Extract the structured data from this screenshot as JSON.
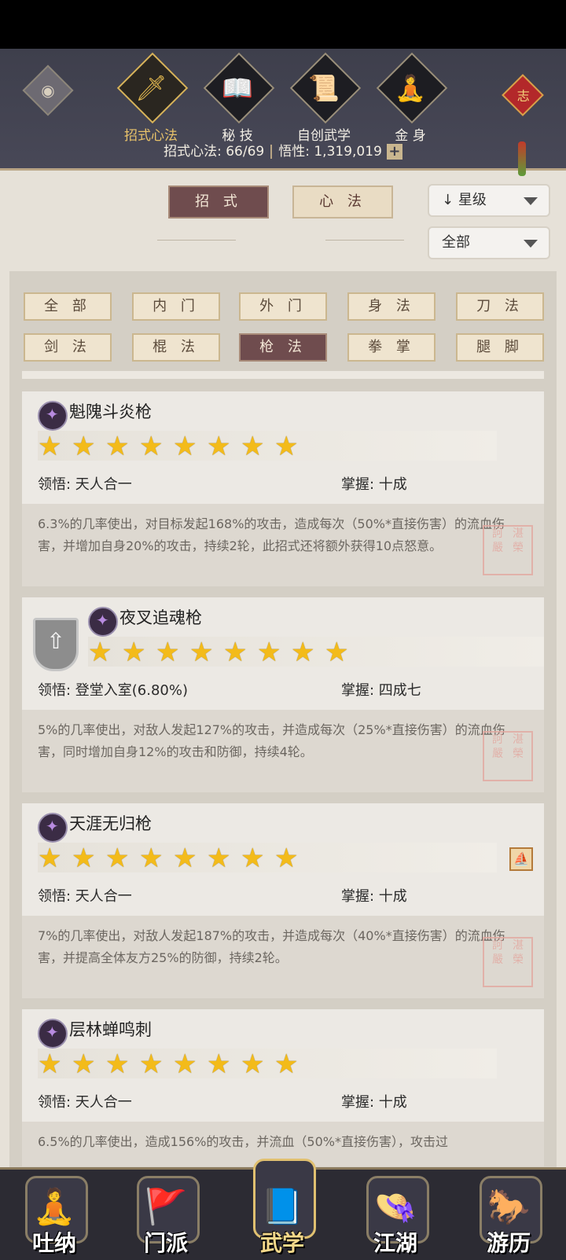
{
  "top": {
    "tabs": [
      {
        "label": "招式心法",
        "icon": "sword-icon",
        "glyph": "🗡"
      },
      {
        "label": "秘 技",
        "icon": "book-icon",
        "glyph": "📖"
      },
      {
        "label": "自创武学",
        "icon": "scroll-icon",
        "glyph": "📜"
      },
      {
        "label": "金 身",
        "icon": "meditation-icon",
        "glyph": "🧘"
      }
    ],
    "knot_char": "志",
    "stats_text": "招式心法: 66/69",
    "insight_text": "悟性: 1,319,019",
    "plus": "+"
  },
  "filters": {
    "seg_moves": "招 式",
    "seg_mind": "心 法",
    "sort_value": "星级",
    "sort_arrow": "↓",
    "filter_value": "全部"
  },
  "categories": [
    "全 部",
    "内 门",
    "外 门",
    "身 法",
    "刀 法",
    "剑 法",
    "棍 法",
    "枪 法",
    "拳 掌",
    "腿 脚"
  ],
  "cards": [
    {
      "name": "魁隗斗炎枪",
      "stars": "★★★★★★★★",
      "comprehension": "领悟: 天人合一",
      "mastery": "掌握: 十成",
      "desc": "6.3%的几率使出，对目标发起168%的攻击，造成每次（50%*直接伤害）的流血伤害，并增加自身20%的攻击，持续2轮，此招式还将额外获得10点怒意。"
    },
    {
      "name": "夜叉追魂枪",
      "stars": "★★★★★★★★",
      "comprehension": "领悟: 登堂入室(6.80%)",
      "mastery": "掌握: 四成七",
      "desc": "5%的几率使出，对敌人发起127%的攻击，并造成每次（25%*直接伤害）的流血伤害，同时增加自身12%的攻击和防御，持续4轮。"
    },
    {
      "name": "天涯无归枪",
      "stars": "★★★★★★★★",
      "comprehension": "领悟: 天人合一",
      "mastery": "掌握: 十成",
      "desc": "7%的几率使出，对敌人发起187%的攻击，并造成每次（40%*直接伤害）的流血伤害，并提高全体友方25%的防御，持续2轮。"
    },
    {
      "name": "层林蝉鸣刺",
      "stars": "★★★★★★★★",
      "comprehension": "领悟: 天人合一",
      "mastery": "掌握: 十成",
      "desc": "6.5%的几率使出，造成156%的攻击，并流血（50%*直接伤害），攻击过"
    }
  ],
  "seal_text": "訶 湛 嚴 榮",
  "bottom_nav": [
    {
      "label": "吐纳",
      "icon": "monk-icon",
      "glyph": "🧘"
    },
    {
      "label": "门派",
      "icon": "banner-icon",
      "glyph": "🚩"
    },
    {
      "label": "武学",
      "icon": "manual-icon",
      "glyph": "📘"
    },
    {
      "label": "江湖",
      "icon": "straw-hat-icon",
      "glyph": "👒"
    },
    {
      "label": "游历",
      "icon": "horse-icon",
      "glyph": "🐎"
    }
  ]
}
